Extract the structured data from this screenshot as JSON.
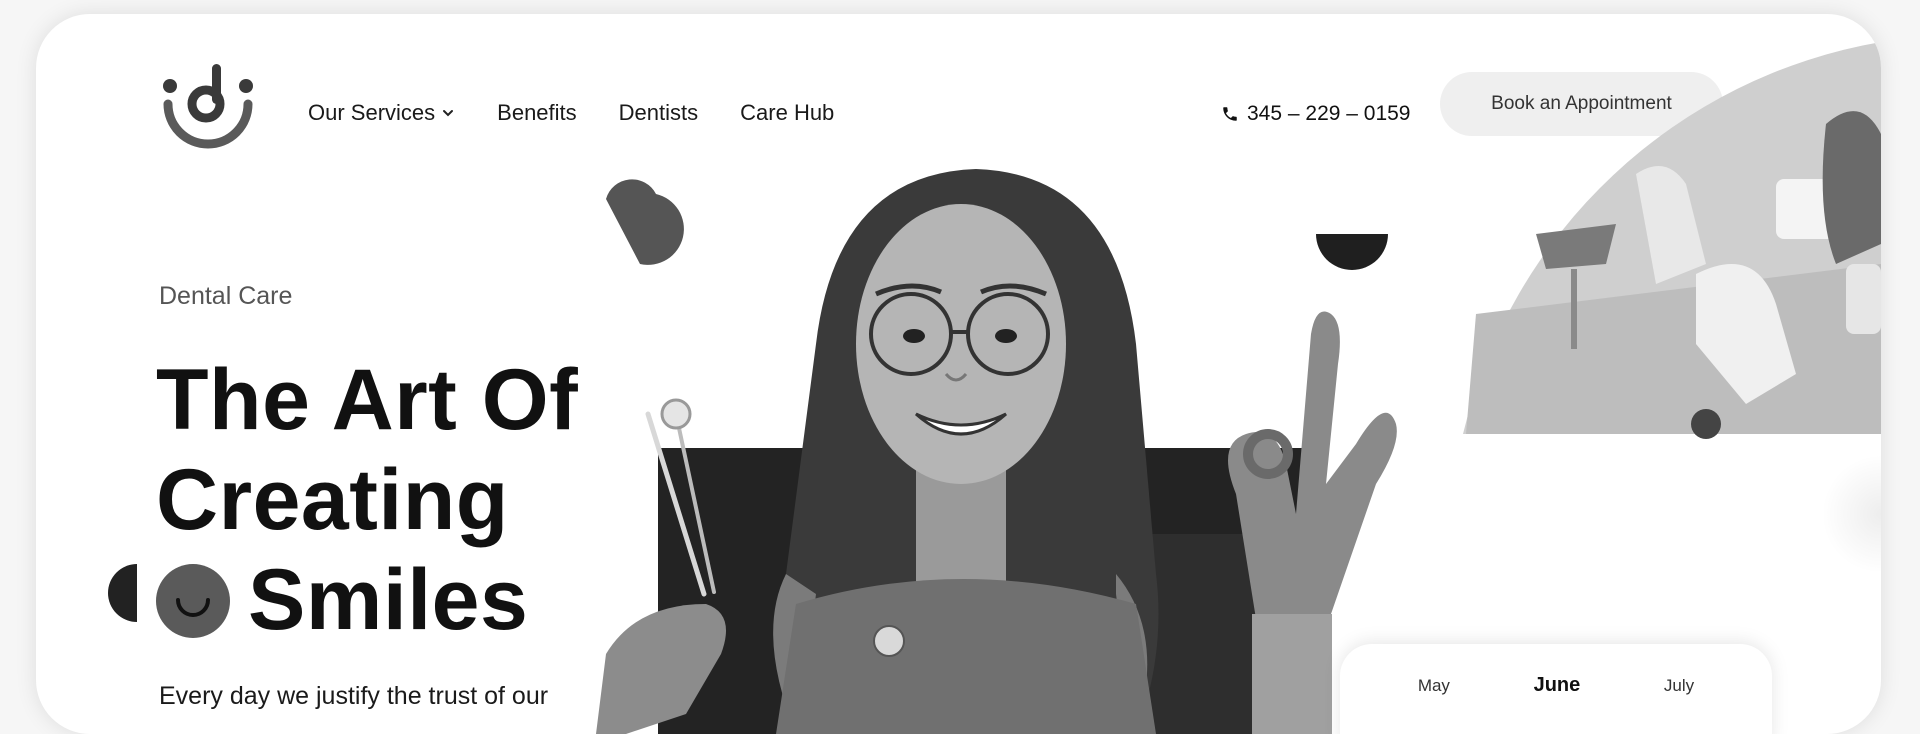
{
  "brand": {
    "logo_name": "dental-logo"
  },
  "nav": {
    "items": [
      {
        "label": "Our Services",
        "has_dropdown": true
      },
      {
        "label": "Benefits"
      },
      {
        "label": "Dentists"
      },
      {
        "label": "Care Hub"
      }
    ]
  },
  "header": {
    "phone": "345 – 229 – 0159",
    "phone_icon": "phone-icon",
    "cta_label": "Book an Appointment"
  },
  "hero": {
    "eyebrow": "Dental Care",
    "title_line1": "The Art Of",
    "title_line2": "Creating",
    "title_line3": "Smiles",
    "description": "Every day we justify the trust of our"
  },
  "calendar": {
    "months": [
      "May",
      "June",
      "July"
    ],
    "selected": "June"
  },
  "colors": {
    "page_bg": "#f6f6f6",
    "card_bg": "#ffffff",
    "button_bg": "#efefef",
    "text": "#111111"
  }
}
